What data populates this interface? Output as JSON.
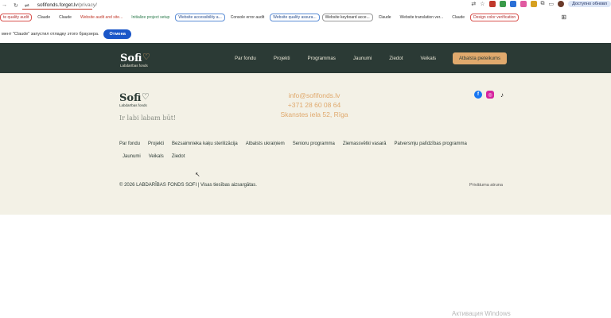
{
  "browser": {
    "url_host": "sofifonds.forget.lv",
    "url_path": "/privacy/",
    "update_label": "Доступно обновл"
  },
  "bookmarks": [
    {
      "label": "te quality audit",
      "style": "red"
    },
    {
      "label": "Claude",
      "style": "plain"
    },
    {
      "label": "Claude",
      "style": "plain"
    },
    {
      "label": "Website audit and site...",
      "style": "rtext"
    },
    {
      "label": "Initialize project setup",
      "style": "green"
    },
    {
      "label": "Website accessibility a...",
      "style": "blue"
    },
    {
      "label": "Console error audit",
      "style": "plain"
    },
    {
      "label": "Website quality assura...",
      "style": "blue"
    },
    {
      "label": "Website keyboard acce...",
      "style": "grey"
    },
    {
      "label": "Claude",
      "style": "plain"
    },
    {
      "label": "Website translation ver...",
      "style": "plain"
    },
    {
      "label": "Claude",
      "style": "plain"
    },
    {
      "label": "Design color verification",
      "style": "red"
    }
  ],
  "debug": {
    "message": "мент \"Claude\" запустил отладку этого браузера.",
    "cancel_label": "Отмена"
  },
  "header": {
    "logo_name": "Sofi",
    "logo_sub": "Labdarības fonds",
    "menu": [
      "Par fondu",
      "Projekti",
      "Programmas",
      "Jaunumi",
      "Ziedot",
      "Veikals"
    ],
    "support_label": "Atbalsta pieteikums"
  },
  "footer": {
    "logo_name": "Sofi",
    "logo_sub": "Labdarības fonds",
    "tagline": "Ir labi labam būt!",
    "email": "info@sofifonds.lv",
    "phone": "+371 28 60 08 64",
    "address": "Skanstes iela 52, Rīga",
    "links_row1": [
      "Par fondu",
      "Projekti",
      "Bezsaimnieka kaķu sterilizācija",
      "Atbalsts ukraiņiem",
      "Senioru programma",
      "Ziemassvētki vasarā",
      "Patversmju palīdzības programma"
    ],
    "links_row2": [
      "Jaunumi",
      "Veikals",
      "Ziedot"
    ],
    "copyright": "© 2026 LABDARĪBAS FONDS SOFI | Visas tiesības aizsargātas.",
    "privacy": "Privātuma atruna"
  },
  "os": {
    "watermark": "Активация Windows"
  },
  "colors": {
    "header_bg": "#2b3a35",
    "footer_bg": "#f3f1e6",
    "accent": "#e0a96d"
  }
}
